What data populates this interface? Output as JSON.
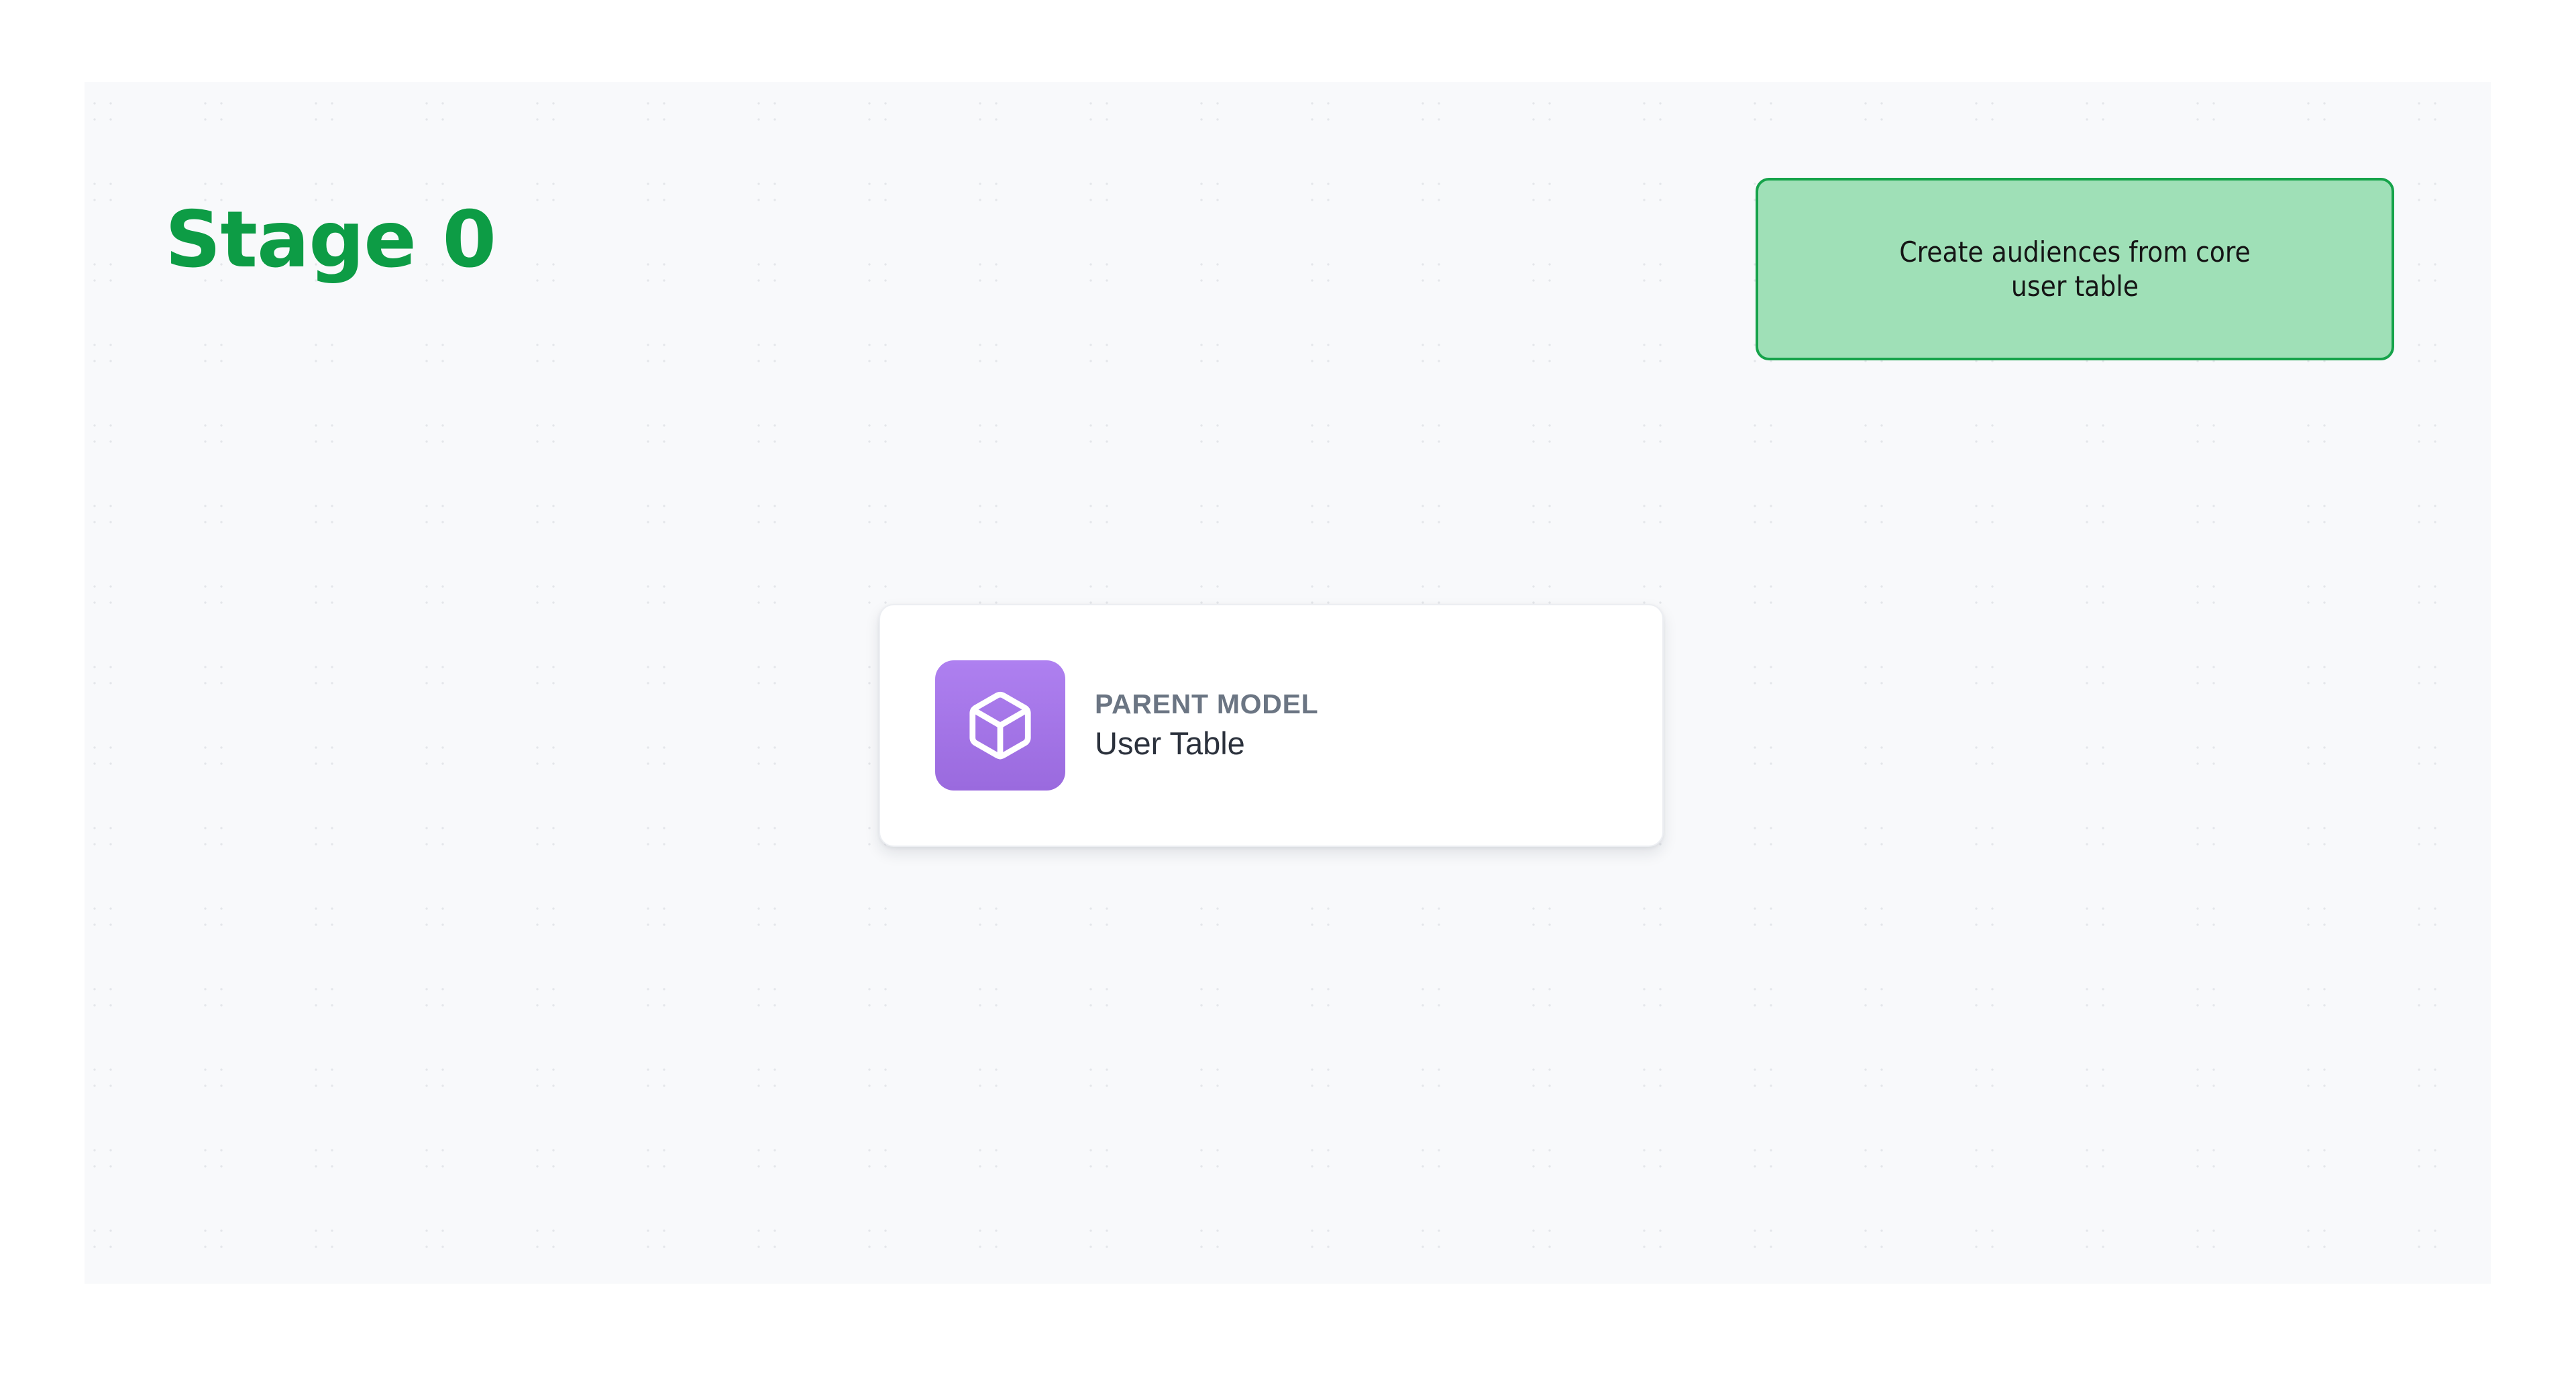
{
  "canvas": {
    "background_color": "#f8f9fb",
    "dot_color": "#e4e6ea"
  },
  "stage": {
    "title": "Stage 0",
    "color": "#0d9c45"
  },
  "annotation": {
    "text": "Create audiences from core\nuser table",
    "fill_color": "#9fe0b7",
    "border_color": "#16a34a",
    "text_color": "#151515"
  },
  "node": {
    "kicker": "PARENT MODEL",
    "title": "User Table",
    "icon": "cube-icon",
    "icon_tile_color_top": "#ae80f0",
    "icon_tile_color_bottom": "#9a6ade",
    "kicker_color": "#6b7583",
    "title_color": "#2b313c",
    "card_background": "#ffffff"
  }
}
